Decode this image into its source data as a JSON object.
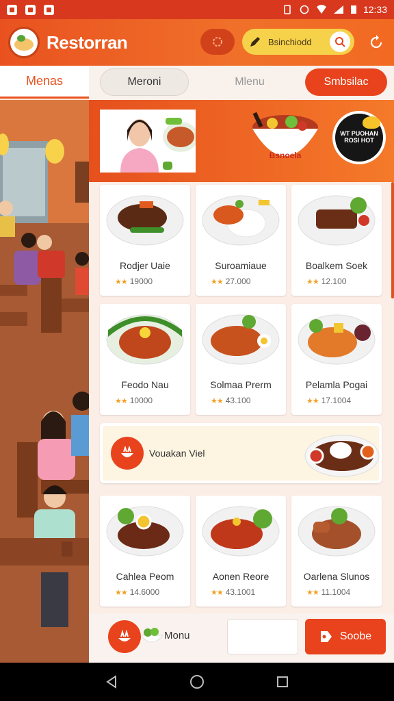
{
  "status_bar": {
    "time": "12:33"
  },
  "header": {
    "title": "Restorran",
    "search_text": "Bsinchiodd"
  },
  "tabs": {
    "left": "Menas",
    "pill_1": "Meroni",
    "pill_2": "Mlenu",
    "pill_3": "Smbsilac"
  },
  "banner": {
    "bowl_label": "Bsnoela",
    "badge_text": "WT PUOHAN ROSI HOT"
  },
  "menu_rows": [
    [
      {
        "name": "Rodjer Uaie",
        "rating": "19000"
      },
      {
        "name": "Suroamiaue",
        "rating": "27.000"
      },
      {
        "name": "Boalkem Soek",
        "rating": "12.100"
      }
    ],
    [
      {
        "name": "Feodo Nau",
        "rating": "10000"
      },
      {
        "name": "Solmaa Prerm",
        "rating": "43.100"
      },
      {
        "name": "Pelamla Pogai",
        "rating": "17.1004"
      }
    ],
    [
      {
        "name": "Cahlea Peom",
        "rating": "14.6000"
      },
      {
        "name": "Aonen Reore",
        "rating": "43.1001"
      },
      {
        "name": "Oarlena Slunos",
        "rating": "11.1004"
      }
    ]
  ],
  "promo": {
    "text": "Vouakan Viel"
  },
  "bottom_bar": {
    "fab_label": "Monu",
    "cta_label": "Soobe"
  },
  "colors": {
    "accent": "#e8431c",
    "header": "#f0702a",
    "search": "#f6d24a",
    "star": "#f0a021"
  }
}
